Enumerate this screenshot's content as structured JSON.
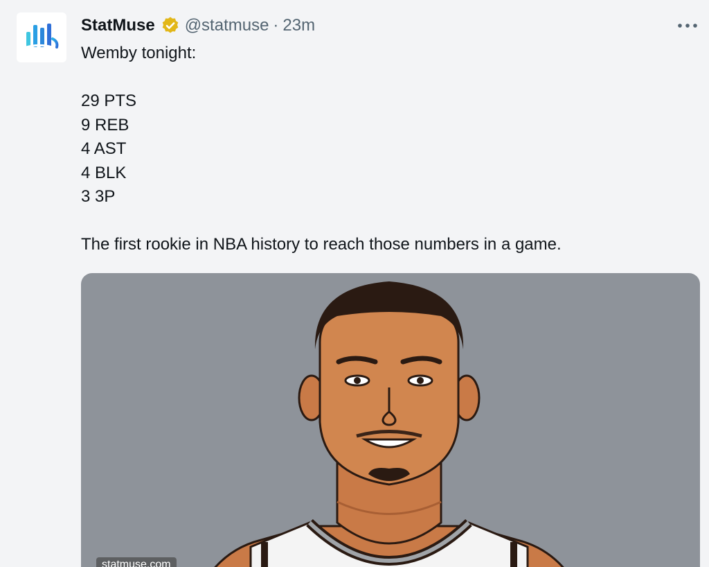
{
  "tweet": {
    "display_name": "StatMuse",
    "handle": "@statmuse",
    "separator": "·",
    "time": "23m",
    "lines": {
      "intro": "Wemby tonight:",
      "stat1": "29 PTS",
      "stat2": "9 REB",
      "stat3": "4 AST",
      "stat4": "4 BLK",
      "stat5": "3 3P",
      "closing": "The first rookie in NBA history to reach those numbers in a game."
    }
  },
  "media": {
    "watermark": "statmuse.com"
  },
  "colors": {
    "background": "#f3f4f6",
    "media_background": "#8e939a",
    "verified_gold": "#e2b719",
    "logo_blue": "#1d9bf0",
    "muted_text": "#536471"
  },
  "icons": {
    "verified": "verified-badge-icon",
    "more": "more-horizontal-icon",
    "logo": "statmuse-logo-icon"
  }
}
